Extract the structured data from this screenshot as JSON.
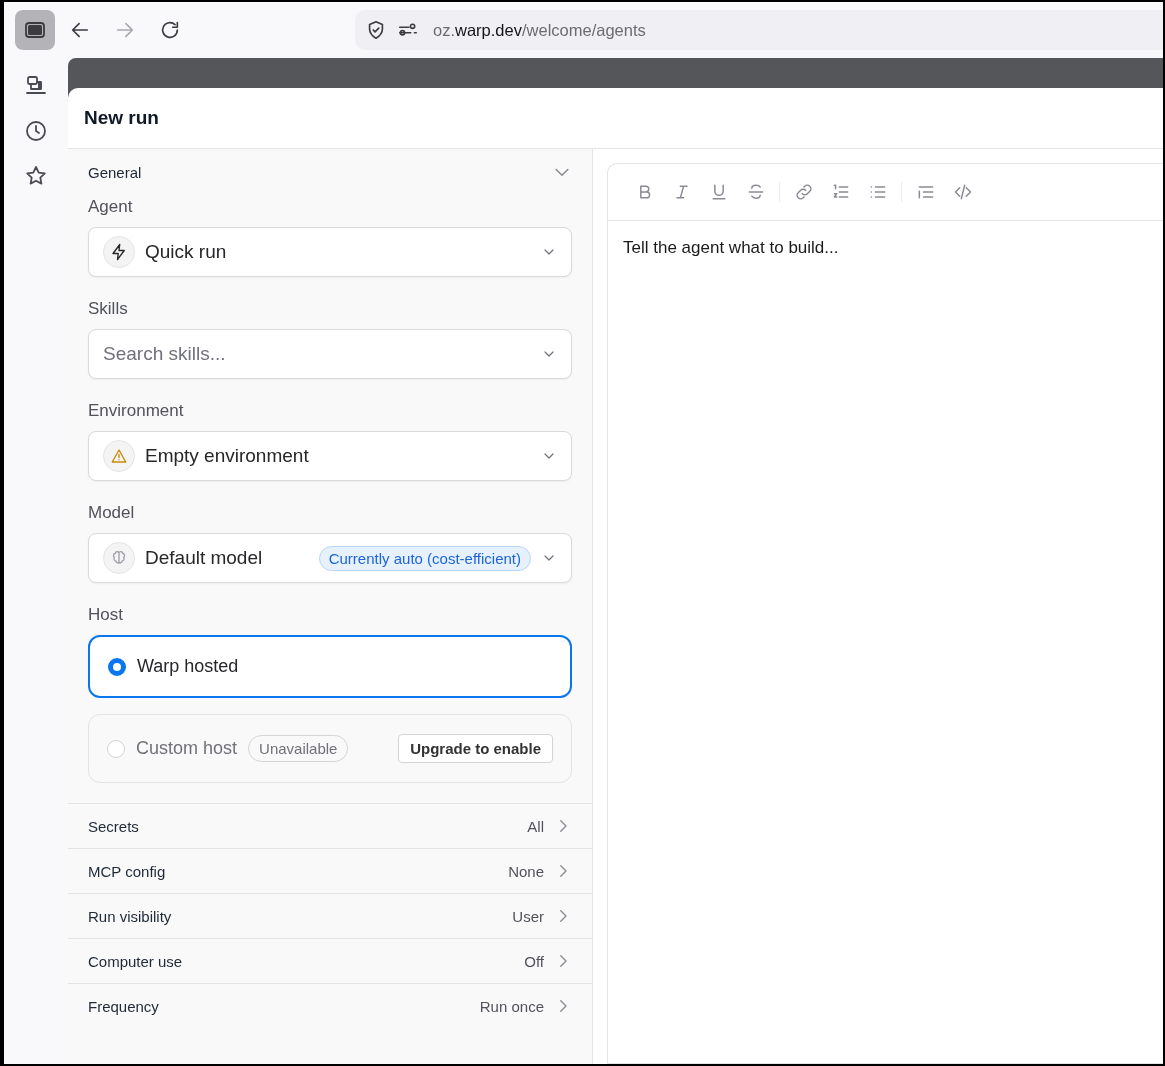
{
  "browser": {
    "url": {
      "subdomain": "oz.",
      "domain": "warp.dev",
      "path": "/welcome/agents"
    }
  },
  "panel": {
    "title": "New run",
    "general": {
      "label": "General",
      "expanded": true
    },
    "fields": [
      {
        "label": "Agent",
        "kind": "value",
        "value": "Quick run"
      },
      {
        "label": "Skills",
        "kind": "search",
        "placeholder": "Search skills..."
      },
      {
        "label": "Environment",
        "kind": "value",
        "value": "Empty environment"
      },
      {
        "label": "Model",
        "kind": "value",
        "value": "Default model",
        "badge": "Currently auto (cost-efficient)"
      }
    ],
    "host": {
      "label": "Host",
      "options": [
        {
          "label": "Warp hosted",
          "selected": true,
          "disabled": false
        },
        {
          "label": "Custom host",
          "selected": false,
          "disabled": true,
          "badge": "Unavailable",
          "action": "Upgrade to enable"
        }
      ]
    },
    "settings": [
      {
        "label": "Secrets",
        "value": "All"
      },
      {
        "label": "MCP config",
        "value": "None"
      },
      {
        "label": "Run visibility",
        "value": "User"
      },
      {
        "label": "Computer use",
        "value": "Off"
      },
      {
        "label": "Frequency",
        "value": "Run once"
      }
    ]
  },
  "editor": {
    "placeholder": "Tell the agent what to build..."
  }
}
